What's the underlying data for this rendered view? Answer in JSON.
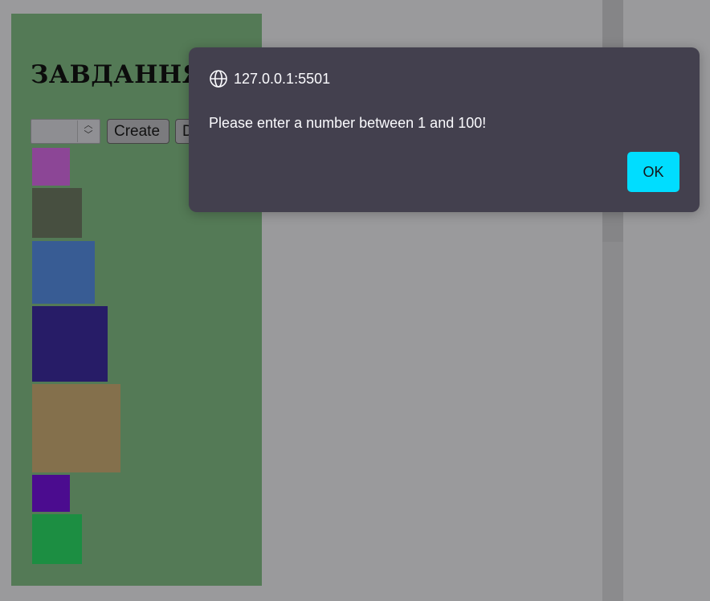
{
  "page": {
    "heading": "ЗАВДАННЯ",
    "controls": {
      "amount_value": "",
      "create_label": "Create",
      "destroy_label": "Destroy"
    },
    "boxes": [
      {
        "color": "#8c4696"
      },
      {
        "color": "#474f40"
      },
      {
        "color": "#385c94"
      },
      {
        "color": "#271c67"
      },
      {
        "color": "#84704c"
      },
      {
        "color": "#4b0c8f"
      },
      {
        "color": "#1c8e42"
      }
    ],
    "colors": {
      "backdrop": "#9a9a9c",
      "panel": "#547a56",
      "dialog": "#43404e",
      "ok_accent": "#00ddff"
    }
  },
  "dialog": {
    "origin": "127.0.0.1:5501",
    "message": "Please enter a number between 1 and 100!",
    "ok_label": "OK"
  }
}
